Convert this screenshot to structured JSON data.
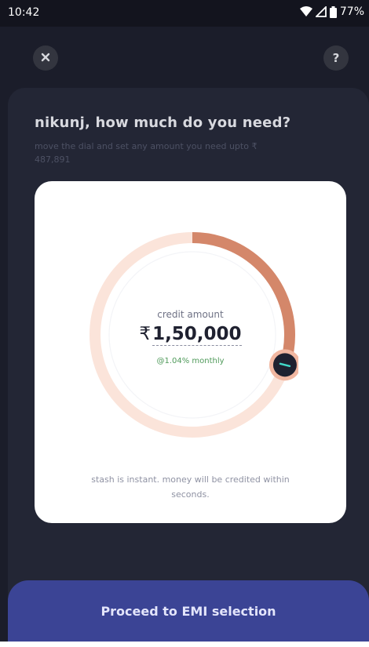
{
  "status_bar": {
    "time": "10:42",
    "battery": "77%",
    "icons": [
      "wifi-icon",
      "signal-icon",
      "battery-icon"
    ]
  },
  "header": {
    "close_icon": "close-icon",
    "help_label": "?"
  },
  "main": {
    "heading": "nikunj, how much do you need?",
    "subtext": "move the dial and set any amount you need upto ₹ 487,891"
  },
  "dial": {
    "label": "credit amount",
    "currency": "₹",
    "amount": "1,50,000",
    "rate": "@1.04% monthly",
    "fill_fraction": 0.3
  },
  "card_note": "stash is instant. money will be credited within seconds.",
  "cta": {
    "label": "Proceed to EMI selection"
  },
  "colors": {
    "accent": "#d4876a",
    "track": "#fbe4da",
    "cta": "#3b4495",
    "background": "#1b1d2a"
  }
}
